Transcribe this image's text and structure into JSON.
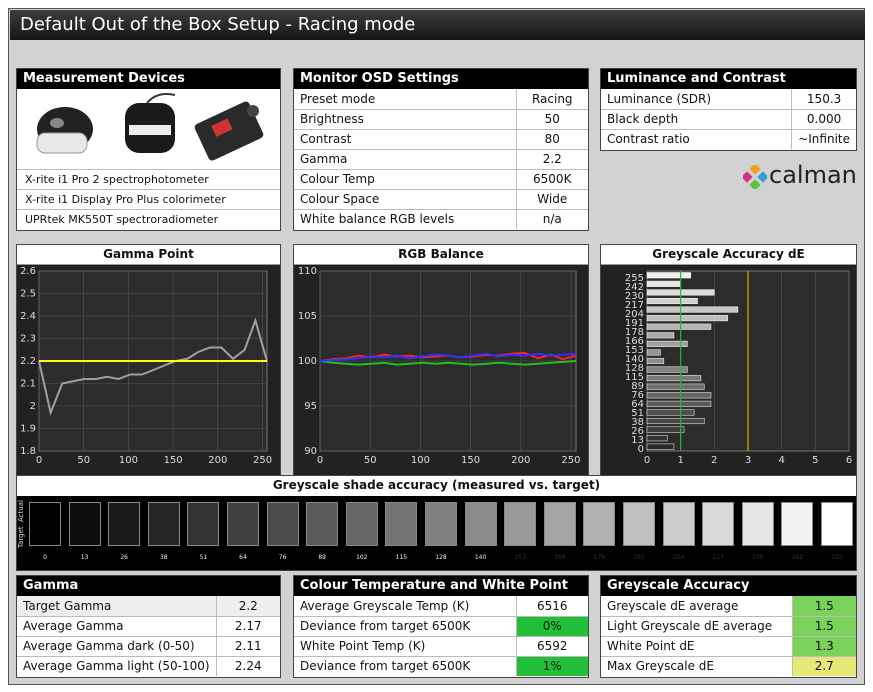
{
  "title": "Default Out of the Box Setup - Racing mode",
  "devices": {
    "header": "Measurement Devices",
    "items": [
      "X-rite i1 Pro 2 spectrophotometer",
      "X-rite i1 Display Pro Plus colorimeter",
      "UPRtek MK550T spectroradiometer"
    ]
  },
  "osd": {
    "header": "Monitor OSD Settings",
    "rows": [
      {
        "label": "Preset mode",
        "value": "Racing"
      },
      {
        "label": "Brightness",
        "value": "50"
      },
      {
        "label": "Contrast",
        "value": "80"
      },
      {
        "label": "Gamma",
        "value": "2.2"
      },
      {
        "label": "Colour Temp",
        "value": "6500K"
      },
      {
        "label": "Colour Space",
        "value": "Wide"
      },
      {
        "label": "White balance RGB levels",
        "value": "n/a"
      }
    ]
  },
  "luminance": {
    "header": "Luminance and Contrast",
    "rows": [
      {
        "label": "Luminance (SDR)",
        "value": "150.3"
      },
      {
        "label": "Black depth",
        "value": "0.000"
      },
      {
        "label": "Contrast ratio",
        "value": "~Infinite"
      }
    ]
  },
  "logo": {
    "text": "calman"
  },
  "chart_data": [
    {
      "type": "line",
      "title": "Gamma Point",
      "x": [
        0,
        13,
        26,
        38,
        51,
        64,
        76,
        89,
        102,
        115,
        128,
        140,
        153,
        166,
        178,
        191,
        204,
        217,
        230,
        242,
        255
      ],
      "series": [
        {
          "values": [
            2.2,
            1.97,
            2.1,
            2.11,
            2.12,
            2.12,
            2.13,
            2.12,
            2.14,
            2.14,
            2.16,
            2.18,
            2.2,
            2.21,
            2.24,
            2.26,
            2.26,
            2.21,
            2.25,
            2.38,
            2.2
          ]
        },
        {
          "values": [
            2.2,
            2.2,
            2.2,
            2.2,
            2.2,
            2.2,
            2.2,
            2.2,
            2.2,
            2.2,
            2.2,
            2.2,
            2.2,
            2.2,
            2.2,
            2.2,
            2.2,
            2.2,
            2.2,
            2.2,
            2.2
          ]
        }
      ],
      "xticks": [
        "0",
        "50",
        "100",
        "150",
        "200",
        "250"
      ],
      "yticks": [
        "1.8",
        "1.9",
        "2",
        "2.1",
        "2.2",
        "2.3",
        "2.4",
        "2.5",
        "2.6"
      ],
      "ylim": [
        1.8,
        2.6
      ],
      "xlim": [
        0,
        255
      ],
      "colors": [
        "#a0a0a0",
        "#ffff00"
      ]
    },
    {
      "type": "line",
      "title": "RGB Balance",
      "x": [
        0,
        13,
        26,
        38,
        51,
        64,
        76,
        89,
        102,
        115,
        128,
        140,
        153,
        166,
        178,
        191,
        204,
        217,
        230,
        242,
        255
      ],
      "series": [
        {
          "values": [
            100,
            100.2,
            100.3,
            100.6,
            100.4,
            100.7,
            100.5,
            100.6,
            100.4,
            100.5,
            100.6,
            100.4,
            100.5,
            100.7,
            100.6,
            100.8,
            100.9,
            100.3,
            100.7,
            100.2,
            100.6
          ]
        },
        {
          "values": [
            100,
            99.8,
            99.7,
            99.6,
            99.7,
            99.8,
            99.6,
            99.7,
            99.8,
            99.7,
            99.8,
            99.7,
            99.6,
            99.7,
            99.8,
            99.7,
            99.6,
            99.7,
            99.8,
            99.9,
            100
          ]
        },
        {
          "values": [
            100,
            100.1,
            100.2,
            100.3,
            100.5,
            100.4,
            100.6,
            100.3,
            100.5,
            100.7,
            100.6,
            100.4,
            100.6,
            100.8,
            100.5,
            100.7,
            100.6,
            100.8,
            100.6,
            100.7,
            100.8
          ]
        }
      ],
      "xticks": [
        "0",
        "50",
        "100",
        "150",
        "200",
        "250"
      ],
      "yticks": [
        "90",
        "95",
        "100",
        "105",
        "110"
      ],
      "ylim": [
        90,
        110
      ],
      "xlim": [
        0,
        255
      ],
      "colors": [
        "#ff2020",
        "#20c020",
        "#3030ff"
      ]
    },
    {
      "type": "bar",
      "title": "Greyscale Accuracy dE",
      "categories": [
        "0",
        "13",
        "26",
        "38",
        "51",
        "64",
        "76",
        "89",
        "102",
        "115",
        "128",
        "140",
        "153",
        "166",
        "178",
        "191",
        "204",
        "217",
        "230",
        "242",
        "255"
      ],
      "values": [
        0.8,
        0.6,
        1.1,
        1.7,
        1.4,
        1.9,
        1.9,
        1.7,
        1.6,
        1.2,
        0.5,
        0.4,
        1.2,
        0.8,
        1.9,
        2.4,
        2.7,
        1.5,
        2.0,
        1.0,
        1.3
      ],
      "yticklabels": [
        "255",
        "242",
        "230",
        "217",
        "204",
        "191",
        "178",
        "166",
        "153",
        "140",
        "128",
        "115",
        "89",
        "76",
        "64",
        "51",
        "38",
        "26",
        "13",
        "0"
      ],
      "xticks": [
        "0",
        "1",
        "2",
        "3",
        "4",
        "5",
        "6"
      ],
      "xlim": [
        0,
        6
      ],
      "ref_lines": [
        {
          "x": 1,
          "color": "#20c020"
        },
        {
          "x": 3,
          "color": "#d0b000"
        }
      ]
    }
  ],
  "shades": {
    "title": "Greyscale shade accuracy (measured vs. target)",
    "row_labels": [
      "Actual",
      "Target"
    ],
    "levels": [
      "0",
      "13",
      "26",
      "38",
      "51",
      "64",
      "76",
      "89",
      "102",
      "115",
      "128",
      "140",
      "153",
      "166",
      "178",
      "191",
      "204",
      "217",
      "230",
      "242",
      "255"
    ]
  },
  "gamma": {
    "header": "Gamma",
    "rows": [
      {
        "label": "Target Gamma",
        "value": "2.2"
      },
      {
        "label": "Average Gamma",
        "value": "2.17"
      },
      {
        "label": "Average Gamma dark (0-50)",
        "value": "2.11"
      },
      {
        "label": "Average Gamma light (50-100)",
        "value": "2.24"
      }
    ]
  },
  "colourtemp": {
    "header": "Colour Temperature and White Point",
    "rows": [
      {
        "label": "Average Greyscale Temp (K)",
        "value": "6516",
        "color": "#ffffff"
      },
      {
        "label": "Deviance from target 6500K",
        "value": "0%",
        "color": "#22c03a"
      },
      {
        "label": "White Point Temp (K)",
        "value": "6592",
        "color": "#ffffff"
      },
      {
        "label": "Deviance from target 6500K",
        "value": "1%",
        "color": "#22c03a"
      }
    ]
  },
  "greyacc": {
    "header": "Greyscale Accuracy",
    "rows": [
      {
        "label": "Greyscale dE average",
        "value": "1.5",
        "color": "#7ad25a"
      },
      {
        "label": "Light Greyscale dE average",
        "value": "1.5",
        "color": "#7ad25a"
      },
      {
        "label": "White Point dE",
        "value": "1.3",
        "color": "#7ad25a"
      },
      {
        "label": "Max Greyscale dE",
        "value": "2.7",
        "color": "#e8e878"
      }
    ]
  }
}
